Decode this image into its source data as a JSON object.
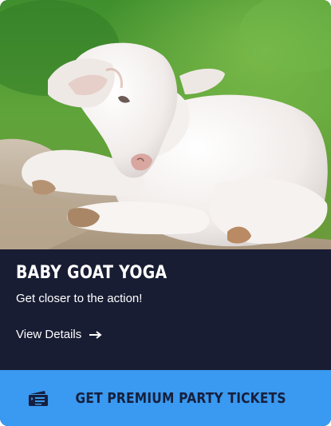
{
  "event": {
    "title": "BABY GOAT YOGA",
    "subtitle": "Get closer to the action!",
    "details_label": "View Details"
  },
  "cta": {
    "label": "GET PREMIUM PARTY TICKETS",
    "icon": "ticket-icon"
  },
  "colors": {
    "info_bg": "#181d33",
    "cta_bg": "#3a99f0",
    "cta_text": "#16203d"
  }
}
